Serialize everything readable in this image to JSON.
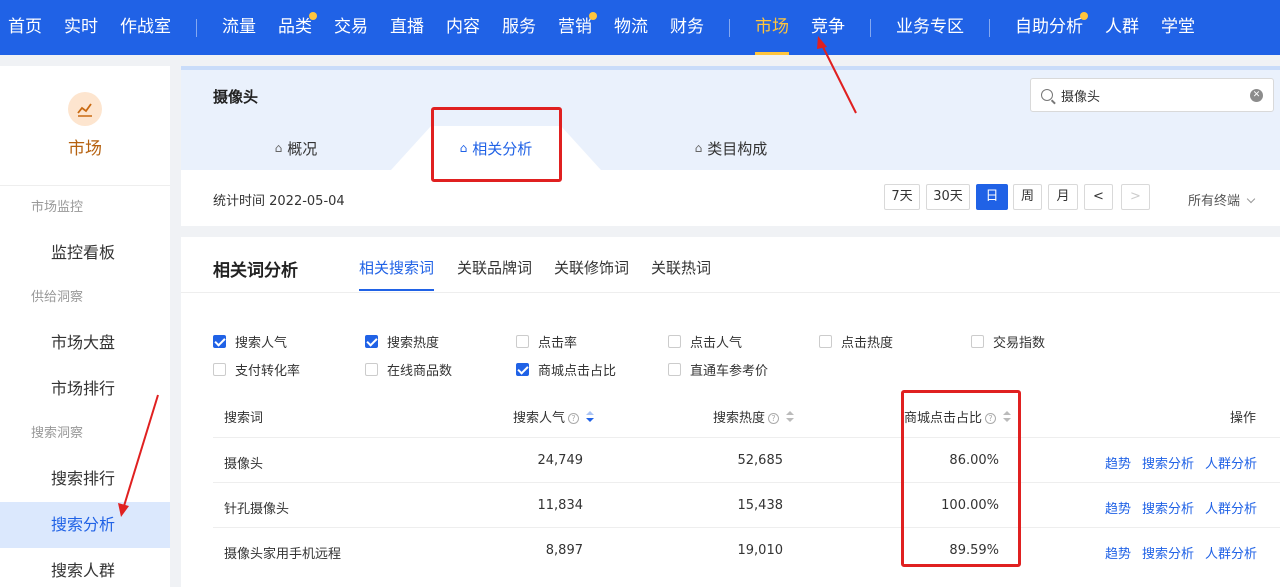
{
  "topnav": {
    "items": [
      {
        "label": "首页",
        "dot": false
      },
      {
        "label": "实时",
        "dot": false
      },
      {
        "label": "作战室",
        "dot": false
      },
      {
        "label": "流量",
        "dot": false
      },
      {
        "label": "品类",
        "dot": true
      },
      {
        "label": "交易",
        "dot": false
      },
      {
        "label": "直播",
        "dot": false
      },
      {
        "label": "内容",
        "dot": false
      },
      {
        "label": "服务",
        "dot": false
      },
      {
        "label": "营销",
        "dot": true
      },
      {
        "label": "物流",
        "dot": false
      },
      {
        "label": "财务",
        "dot": false
      },
      {
        "label": "市场",
        "dot": false,
        "active": true
      },
      {
        "label": "竞争",
        "dot": false
      },
      {
        "label": "业务专区",
        "dot": false
      },
      {
        "label": "自助分析",
        "dot": true
      },
      {
        "label": "人群",
        "dot": false
      },
      {
        "label": "学堂",
        "dot": false
      }
    ],
    "accent": "#ffc53d",
    "background": "#2062e6"
  },
  "sidebar": {
    "title": "市场",
    "logo_icon": "trend-chart-icon",
    "groups": [
      {
        "label": "市场监控",
        "items": [
          "监控看板"
        ]
      },
      {
        "label": "供给洞察",
        "items": [
          "市场大盘",
          "市场排行"
        ]
      },
      {
        "label": "搜索洞察",
        "items": [
          "搜索排行",
          "搜索分析",
          "搜索人群"
        ]
      }
    ],
    "active_item": "搜索分析"
  },
  "header": {
    "title": "摄像头",
    "search_value": "摄像头",
    "tabs": [
      {
        "label": "概况",
        "icon": "bag-icon"
      },
      {
        "label": "相关分析",
        "icon": "bag-icon",
        "active": true
      },
      {
        "label": "类目构成",
        "icon": "bag-icon"
      }
    ],
    "stat_time": "统计时间 2022-05-04",
    "periods": [
      "7天",
      "30天",
      "日",
      "周",
      "月"
    ],
    "active_period": "日",
    "prev": "<",
    "next": ">",
    "terminal": "所有终端"
  },
  "main": {
    "section_title": "相关词分析",
    "subtabs": [
      "相关搜索词",
      "关联品牌词",
      "关联修饰词",
      "关联热词"
    ],
    "active_subtab": "相关搜索词",
    "metrics": [
      {
        "label": "搜索人气",
        "checked": true
      },
      {
        "label": "搜索热度",
        "checked": true
      },
      {
        "label": "点击率",
        "checked": false
      },
      {
        "label": "点击人气",
        "checked": false
      },
      {
        "label": "点击热度",
        "checked": false
      },
      {
        "label": "交易指数",
        "checked": false
      },
      {
        "label": "支付转化率",
        "checked": false
      },
      {
        "label": "在线商品数",
        "checked": false
      },
      {
        "label": "商城点击占比",
        "checked": true
      },
      {
        "label": "直通车参考价",
        "checked": false
      }
    ],
    "table": {
      "headers": [
        "搜索词",
        "搜索人气",
        "搜索热度",
        "商城点击占比",
        "操作"
      ],
      "rows": [
        {
          "word": "摄像头",
          "popularity": "24,749",
          "heat": "52,685",
          "mall_ratio": "86.00%"
        },
        {
          "word": "针孔摄像头",
          "popularity": "11,834",
          "heat": "15,438",
          "mall_ratio": "100.00%"
        },
        {
          "word": "摄像头家用手机远程",
          "popularity": "8,897",
          "heat": "19,010",
          "mall_ratio": "89.59%"
        }
      ],
      "actions": [
        "趋势",
        "搜索分析",
        "人群分析"
      ]
    }
  }
}
